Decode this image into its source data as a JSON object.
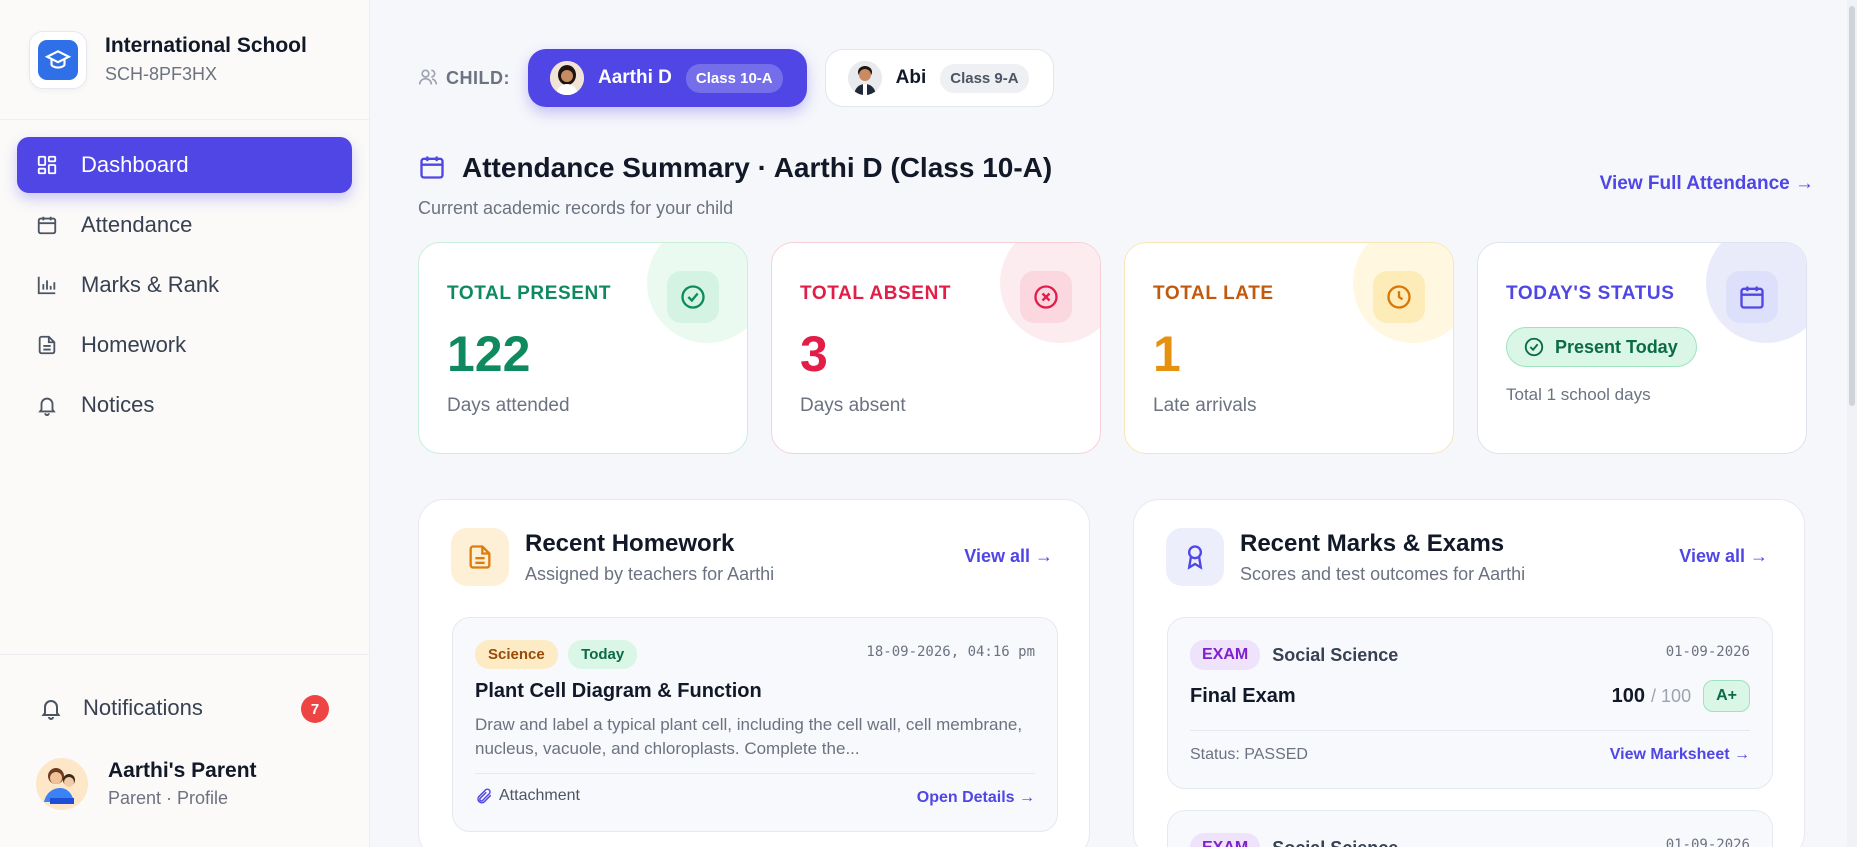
{
  "school": {
    "name": "International School",
    "code": "SCH-8PF3HX"
  },
  "nav": [
    {
      "label": "Dashboard",
      "icon": "grid-icon"
    },
    {
      "label": "Attendance",
      "icon": "calendar-icon"
    },
    {
      "label": "Marks & Rank",
      "icon": "bar-chart-icon"
    },
    {
      "label": "Homework",
      "icon": "document-icon"
    },
    {
      "label": "Notices",
      "icon": "bell-icon"
    }
  ],
  "notifications": {
    "label": "Notifications",
    "count": "7"
  },
  "profile": {
    "name": "Aarthi's Parent",
    "sub": "Parent · Profile"
  },
  "child_selector": {
    "label": "CHILD:",
    "children": [
      {
        "name": "Aarthi D",
        "class": "Class 10-A"
      },
      {
        "name": "Abi",
        "class": "Class 9-A"
      }
    ]
  },
  "summary": {
    "title": "Attendance Summary · Aarthi D (Class 10-A)",
    "subtitle": "Current academic records for your child",
    "view_full": "View Full Attendance →"
  },
  "stats": {
    "present": {
      "label": "TOTAL PRESENT",
      "value": "122",
      "desc": "Days attended"
    },
    "absent": {
      "label": "TOTAL ABSENT",
      "value": "3",
      "desc": "Days absent"
    },
    "late": {
      "label": "TOTAL LATE",
      "value": "1",
      "desc": "Late arrivals"
    },
    "today": {
      "label": "TODAY'S STATUS",
      "status": "Present Today",
      "desc": "Total 1 school days"
    }
  },
  "homework": {
    "title": "Recent Homework",
    "subtitle": "Assigned by teachers for Aarthi",
    "view_all": "View all →",
    "items": [
      {
        "subject": "Science",
        "when": "Today",
        "datetime": "18-09-2026, 04:16 pm",
        "title": "Plant Cell Diagram & Function",
        "desc": "Draw and label a typical plant cell, including the cell wall, cell membrane, nucleus, vacuole, and chloroplasts. Complete the...",
        "attachment": "Attachment",
        "open": "Open Details →"
      }
    ]
  },
  "marks": {
    "title": "Recent Marks & Exams",
    "subtitle": "Scores and test outcomes for Aarthi",
    "view_all": "View all →",
    "items": [
      {
        "type": "EXAM",
        "subject": "Social Science",
        "date": "01-09-2026",
        "title": "Final Exam",
        "score": "100",
        "out_of": "/ 100",
        "grade": "A+",
        "status": "Status: PASSED",
        "sheet": "View Marksheet →"
      },
      {
        "type": "EXAM",
        "subject": "Social Science",
        "date": "01-09-2026"
      }
    ]
  },
  "colors": {
    "accent": "#4f46e5",
    "present": "#0f8a5f",
    "absent": "#e11d48",
    "late": "#e69210"
  }
}
